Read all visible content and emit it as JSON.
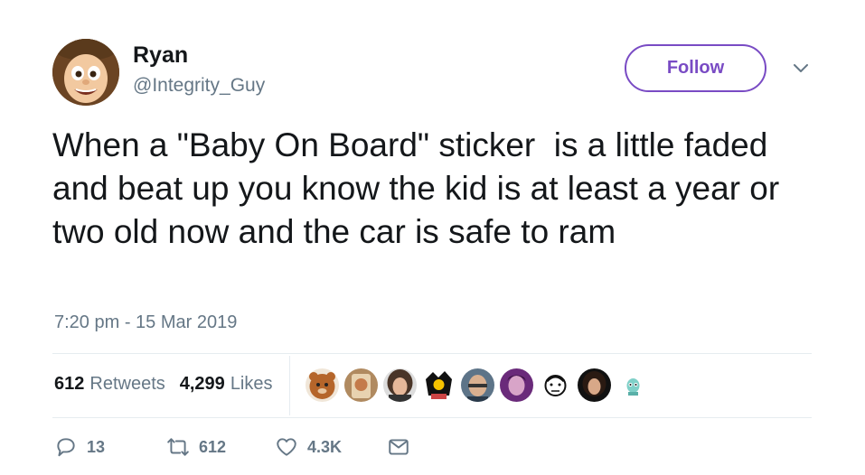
{
  "author": {
    "name": "Ryan",
    "handle": "@Integrity_Guy"
  },
  "follow_label": "Follow",
  "tweet_text": "When a \"Baby On Board\" sticker  is a little faded and beat up you know the kid is at least a year or two old now and the car is safe to ram",
  "timestamp": "7:20 pm - 15 Mar 2019",
  "stats": {
    "retweets_count": "612",
    "retweets_label": "Retweets",
    "likes_count": "4,299",
    "likes_label": "Likes"
  },
  "actions": {
    "reply_count": "13",
    "retweet_count": "612",
    "like_count": "4.3K"
  },
  "colors": {
    "accent": "#794bc4",
    "text": "#14171a",
    "secondary": "#657786",
    "divider": "#e6ecf0"
  },
  "icons": [
    "reply-icon",
    "retweet-icon",
    "like-icon",
    "message-icon",
    "chevron-down-icon"
  ]
}
